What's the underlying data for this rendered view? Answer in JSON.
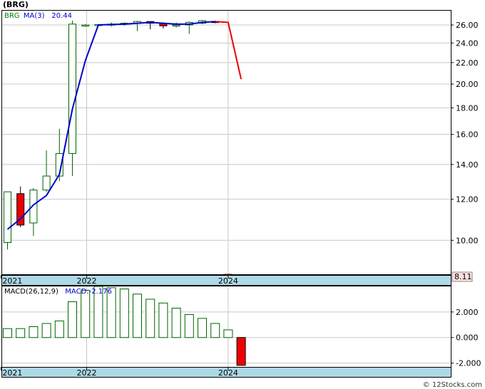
{
  "header": {
    "ticker": "(BRG)"
  },
  "footer": {
    "credit": "© 12Stocks.com"
  },
  "chart_data": [
    {
      "type": "candlestick",
      "symbol": "BRG",
      "legend": [
        {
          "text": "BRG",
          "color": "#008000"
        },
        {
          "text": "MA(3)",
          "color": "#0000cc"
        },
        {
          "text": "20.44",
          "color": "#0000cc"
        }
      ],
      "x_ticks": [
        {
          "label": "2021",
          "i": -0.5
        },
        {
          "label": "2022",
          "i": 6.1
        },
        {
          "label": "2024",
          "i": 17.0
        }
      ],
      "y_scale": "log",
      "ylim": [
        8.6,
        27.7
      ],
      "y_ticks": [
        10.0,
        12.0,
        14.0,
        16.0,
        18.0,
        20.0,
        22.0,
        24.0,
        26.0
      ],
      "y_tick_labels": [
        "10.00",
        "12.00",
        "14.00",
        "16.00",
        "18.00",
        "20.00",
        "22.00",
        "24.00",
        "26.00"
      ],
      "last_price_label": "8.11",
      "last_price_color": "#cc0000",
      "candles": [
        {
          "o": 9.9,
          "h": 12.4,
          "l": 9.6,
          "c": 12.4
        },
        {
          "o": 12.3,
          "h": 12.7,
          "l": 10.6,
          "c": 10.7
        },
        {
          "o": 10.8,
          "h": 12.6,
          "l": 10.2,
          "c": 12.5
        },
        {
          "o": 12.5,
          "h": 14.9,
          "l": 12.4,
          "c": 13.3
        },
        {
          "o": 13.3,
          "h": 16.4,
          "l": 13.0,
          "c": 14.7
        },
        {
          "o": 14.7,
          "h": 26.5,
          "l": 13.3,
          "c": 26.1
        },
        {
          "o": 25.9,
          "h": 26.1,
          "l": 25.8,
          "c": 26.0
        },
        {
          "o": 26.0,
          "h": 26.1,
          "l": 25.9,
          "c": 26.05
        },
        {
          "o": 26.0,
          "h": 26.3,
          "l": 25.8,
          "c": 26.1
        },
        {
          "o": 26.1,
          "h": 26.3,
          "l": 25.9,
          "c": 26.2
        },
        {
          "o": 26.2,
          "h": 26.5,
          "l": 25.3,
          "c": 26.4
        },
        {
          "o": 26.4,
          "h": 26.4,
          "l": 25.5,
          "c": 26.2
        },
        {
          "o": 26.2,
          "h": 26.3,
          "l": 25.6,
          "c": 25.9
        },
        {
          "o": 25.9,
          "h": 26.3,
          "l": 25.7,
          "c": 26.0
        },
        {
          "o": 26.0,
          "h": 26.4,
          "l": 25.0,
          "c": 26.3
        },
        {
          "o": 26.2,
          "h": 26.6,
          "l": 26.1,
          "c": 26.5
        },
        {
          "o": 26.4,
          "h": 26.5,
          "l": 26.2,
          "c": 26.3
        },
        {
          "o": 8.6,
          "h": 8.6,
          "l": 8.11,
          "c": 8.11
        }
      ],
      "ma_points": [
        {
          "i": 0,
          "v": 10.5
        },
        {
          "i": 1,
          "v": 11.0
        },
        {
          "i": 2,
          "v": 11.7
        },
        {
          "i": 3,
          "v": 12.2
        },
        {
          "i": 4,
          "v": 13.4
        },
        {
          "i": 5,
          "v": 17.9
        },
        {
          "i": 6,
          "v": 22.2
        },
        {
          "i": 7,
          "v": 26.0
        },
        {
          "i": 8,
          "v": 26.05
        },
        {
          "i": 9,
          "v": 26.1
        },
        {
          "i": 10,
          "v": 26.2
        },
        {
          "i": 11,
          "v": 26.3
        },
        {
          "i": 12,
          "v": 26.2
        },
        {
          "i": 13,
          "v": 26.1
        },
        {
          "i": 14,
          "v": 26.1
        },
        {
          "i": 15,
          "v": 26.3
        },
        {
          "i": 16,
          "v": 26.4
        },
        {
          "i": 17,
          "v": 26.3
        },
        {
          "i": 18,
          "v": 20.44
        }
      ],
      "ma_down_from_index": 17
    },
    {
      "type": "bar",
      "legend": [
        {
          "text": "MACD(26,12,9)",
          "color": "#000000"
        },
        {
          "text": "MACD:-2.176",
          "color": "#0000cc"
        }
      ],
      "x_ticks": [
        {
          "label": "2021",
          "i": -0.5
        },
        {
          "label": "2022",
          "i": 6.1
        },
        {
          "label": "2024",
          "i": 17.0
        }
      ],
      "ylim": [
        -2.3,
        4.0
      ],
      "y_ticks": [
        -2.0,
        0.0,
        2.0
      ],
      "y_tick_labels": [
        "-2.000",
        "0.000",
        "2.000"
      ],
      "values": [
        0.7,
        0.7,
        0.85,
        1.1,
        1.3,
        2.8,
        3.7,
        4.0,
        3.9,
        3.8,
        3.4,
        3.0,
        2.7,
        2.3,
        1.8,
        1.5,
        1.1,
        0.6,
        -2.176
      ]
    }
  ]
}
